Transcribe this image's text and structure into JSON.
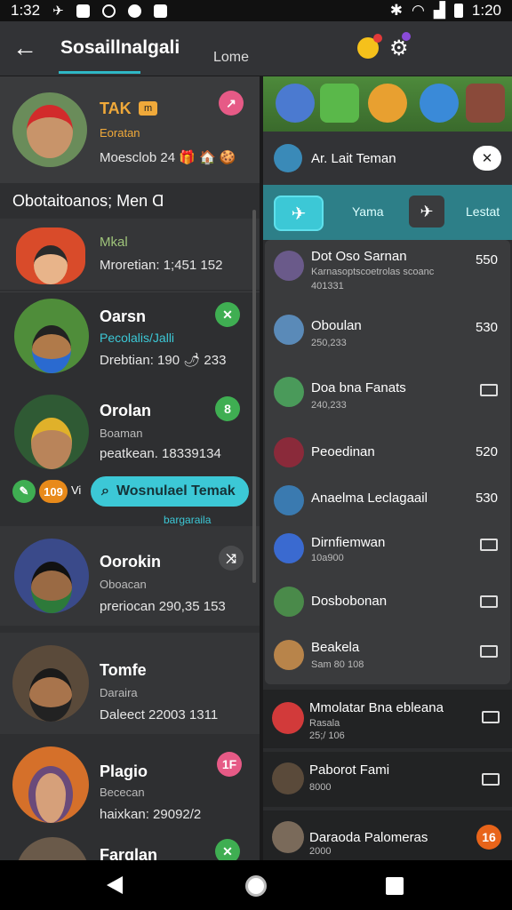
{
  "status_bar": {
    "time_left": "1:32",
    "time_right": "1:20"
  },
  "app_bar": {
    "title": "Sosaillnalgali",
    "tab": "Lome"
  },
  "profile": {
    "name": "TAK",
    "badge": "m",
    "subtitle": "Eoratan",
    "stats": "Moesclob 24 🎁 🏠 🍪"
  },
  "left_section_header": "Obotaitoanos; Men Ɑ",
  "friends": [
    {
      "name": "Mkal",
      "line1": "",
      "line2": "Mroretian: 1;451 152"
    },
    {
      "name": "Oarsn",
      "line1": "Pecolalis/Jalli",
      "line2": "Drebtian: 190 🌶 233"
    },
    {
      "name": "Orolan",
      "line1": "Boaman",
      "line2": "peatkean. 18339134"
    },
    {
      "name": "Oorokin",
      "line1": "Oboacan",
      "line2": "preriocan 290,35 153"
    },
    {
      "name": "Tomfe",
      "line1": "Daraira",
      "line2": "Daleect 22003 1311"
    },
    {
      "name": "Plagio",
      "line1": "Bececan",
      "line2": "haixkan: 29092/2"
    },
    {
      "name": "Farglan",
      "line1": "",
      "line2": ""
    }
  ],
  "action": {
    "chip1": "",
    "chip2": "109",
    "chip3": "Vi",
    "cta": "Wosnulael Temak",
    "cta_sub": "bargaraila"
  },
  "right": {
    "add_row": "Ar. Lait Teman",
    "tabs": {
      "tab1": "Yama",
      "tab2": "Lestat"
    },
    "list": [
      {
        "name": "Dot Oso Sarnan",
        "sub": "Karnasoptscoetrolas scoanc",
        "sub2": "401331",
        "value": "550"
      },
      {
        "name": "Oboulan",
        "sub": "250,233",
        "sub2": "",
        "value": "530"
      },
      {
        "name": "Doa bna Fanats",
        "sub": "240,233",
        "sub2": "",
        "value": ""
      },
      {
        "name": "Peoedinan",
        "sub": "",
        "sub2": "",
        "value": "520"
      },
      {
        "name": "Anaelma Leclagaail",
        "sub": "",
        "sub2": "",
        "value": "530"
      },
      {
        "name": "Dirnfiemwan",
        "sub": "10a900",
        "sub2": "",
        "value": ""
      },
      {
        "name": "Dosbobonan",
        "sub": "",
        "sub2": "",
        "value": ""
      },
      {
        "name": "Beakela",
        "sub": "Sam 80 108",
        "sub2": "",
        "value": ""
      }
    ],
    "lower": [
      {
        "name": "Mmolatar Bna ebleana",
        "sub": "Rasala",
        "sub2": "25;/ 106"
      },
      {
        "name": "Paborot Fami",
        "sub": "8000",
        "sub2": ""
      },
      {
        "name": "Daraoda Palomeras",
        "sub": "2000",
        "sub2": ""
      }
    ]
  },
  "colors": {
    "accent": "#3cc8d6",
    "bg": "#2b2c2e"
  }
}
